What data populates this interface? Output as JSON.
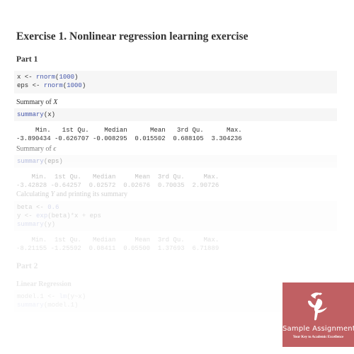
{
  "document": {
    "title": "Exercise 1. Nonlinear regression learning exercise",
    "part1": {
      "heading": "Part 1",
      "code1": {
        "line1": {
          "var": "x",
          "assign": " <- ",
          "fn": "rnorm",
          "open": "(",
          "arg": "1000",
          "close": ")"
        },
        "line2": {
          "var": "eps",
          "assign": " <- ",
          "fn": "rnorm",
          "open": "(",
          "arg": "1000",
          "close": ")"
        }
      },
      "summary_x_label": "Summary of ",
      "summary_x_symbol": "X",
      "code2": {
        "fn": "summary",
        "arg": "(x)"
      },
      "output_x": {
        "headers": "     Min.   1st Qu.    Median      Mean   3rd Qu.      Max. ",
        "values": "-3.890434 -0.626707 -0.008295  0.015502  0.688105  3.304236 "
      },
      "summary_eps_label": "Summary of ",
      "summary_eps_symbol": "ϵ",
      "code3": {
        "fn": "summary",
        "arg": "(eps)"
      },
      "output_eps": {
        "headers": "    Min.  1st Qu.   Median     Mean  3rd Qu.     Max. ",
        "values": "-3.42828 -0.64257  0.02572  0.02676  0.70035  2.90726 "
      },
      "calc_y_label_pre": "Calculating ",
      "calc_y_symbol": "Y",
      "calc_y_label_post": " and printing its summary",
      "code4": {
        "line1": {
          "var": "beta",
          "assign": " <- ",
          "num": "0.6"
        },
        "line2": {
          "var": "y",
          "assign": " <- ",
          "fn": "exp",
          "rest1": "(beta)",
          "op1": "*",
          "rest2": "x ",
          "op2": "+",
          "rest3": " eps"
        },
        "line3": {
          "fn": "summary",
          "arg": "(y)"
        }
      },
      "output_y": {
        "headers": "    Min.  1st Qu.   Median     Mean  3rd Qu.     Max. ",
        "values": "-8.21155 -1.25592  0.08411  0.05500  1.37693  6.71889 "
      }
    },
    "part2": {
      "heading": "Part 2",
      "subheading": "Linear Regression",
      "code5": {
        "line1": {
          "var": "model.1",
          "assign": " <- ",
          "fn": "lm",
          "arg": "(y~x)"
        },
        "line2": {
          "fn": "summary",
          "arg": "(model.1)"
        }
      }
    }
  },
  "logo": {
    "name": "Sample Assignment",
    "tagline": "Your Key to Academic Excellence",
    "background_color": "#c06063",
    "icon": "running-figure-icon"
  }
}
